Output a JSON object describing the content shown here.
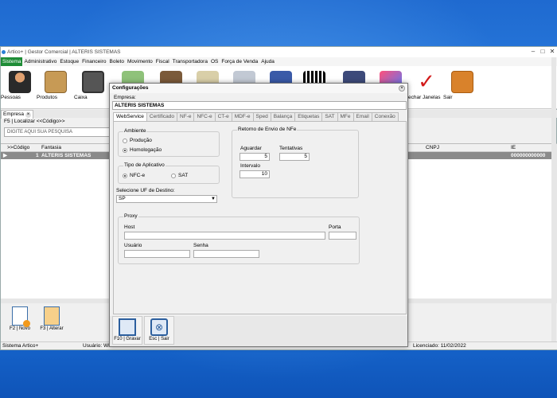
{
  "app": {
    "title": "Artico+ | Gestor Comercial | ALTERIS SISTEMAS",
    "menu": [
      "Sistema",
      "Administrativo",
      "Estoque",
      "Financeiro",
      "Boleto",
      "Movimento",
      "Fiscal",
      "Transportadora",
      "OS",
      "Força de Venda",
      "Ajuda"
    ],
    "toolbar": [
      "Pessoas",
      "Produtos",
      "Caixa",
      "Fechar Janelas",
      "Sair"
    ],
    "tab": "Empresa",
    "locate": "F5 | Localizar <<Código>>",
    "search_placeholder": "DIGITE AQUI SUA PESQUISA",
    "grid": {
      "headers": [
        ">>Código",
        "Fantasia",
        "CNPJ",
        "IE"
      ],
      "row": {
        "codigo": "1",
        "fantasia": "ALTERIS SISTEMAS",
        "ie": "000000000000"
      }
    },
    "bottom_buttons": [
      "F2 | Novo",
      "F3 | Alterar"
    ],
    "status": {
      "left": "Sistema Artico+",
      "user": "Usuário: WE",
      "license": "Licenciado: 11/02/2022"
    }
  },
  "dialog": {
    "title": "Configurações",
    "empresa_label": "Empresa:",
    "empresa_value": "ALTERIS SISTEMAS",
    "tabs": [
      "WebService",
      "Certificado",
      "NF-e",
      "NFC-e",
      "CT-e",
      "MDF-e",
      "Sped",
      "Balança",
      "Etiquetas",
      "SAT",
      "MFe",
      "Email",
      "Conexão"
    ],
    "ambiente": {
      "title": "Ambiente",
      "options": [
        "Produção",
        "Homologação"
      ]
    },
    "tipo": {
      "title": "Tipo de Aplicativo",
      "options": [
        "NFC-e",
        "SAT"
      ]
    },
    "uf": {
      "label": "Selecione UF de Destino:",
      "value": "SP"
    },
    "retorno": {
      "title": "Retorno de Envio de NFe",
      "aguardar_label": "Aguardar",
      "aguardar": "5",
      "tentativas_label": "Tentativas",
      "tentativas": "5",
      "intervalo_label": "Intervalo",
      "intervalo": "10"
    },
    "proxy": {
      "title": "Proxy",
      "host_label": "Host",
      "porta_label": "Porta",
      "usuario_label": "Usuário",
      "senha_label": "Senha"
    },
    "buttons": [
      "F10 | Gravar",
      "Esc | Sair"
    ]
  }
}
